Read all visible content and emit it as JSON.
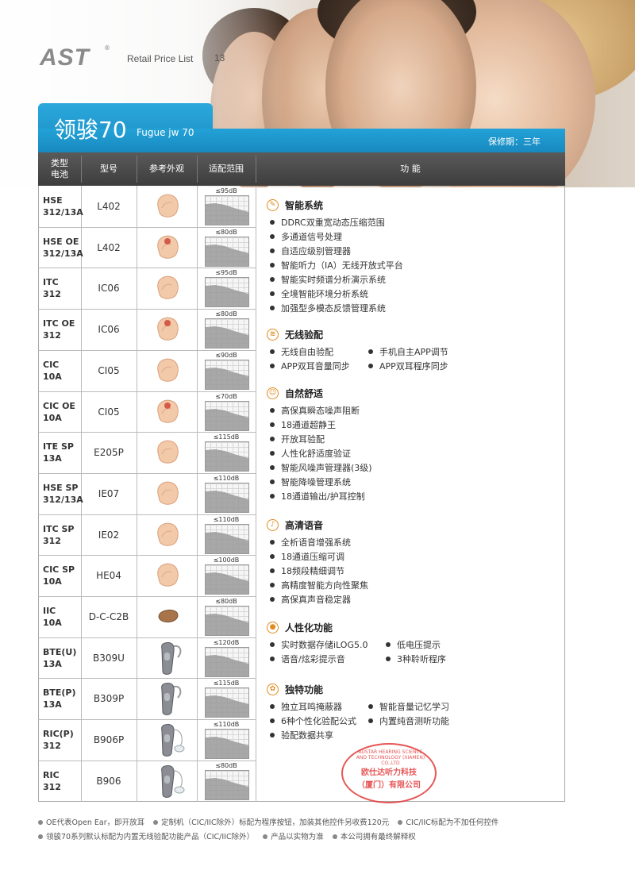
{
  "header": {
    "logo": "AST",
    "logo_reg": "®",
    "title": "Retail Price List",
    "page": "13"
  },
  "product": {
    "name": "领骏70",
    "name_en": "Fugue jw 70",
    "warranty": "保修期：三年"
  },
  "table_header": {
    "type_line1": "类型",
    "type_line2": "电池",
    "model": "型号",
    "look": "参考外观",
    "fit": "适配范围",
    "features": "功  能"
  },
  "rows": [
    {
      "type1": "HSE",
      "type2": "312/13A",
      "model": "L402",
      "fit": "≤95dB"
    },
    {
      "type1": "HSE  OE",
      "type2": "312/13A",
      "model": "L402",
      "fit": "≤80dB"
    },
    {
      "type1": "ITC",
      "type2": "312",
      "model": "IC06",
      "fit": "≤95dB"
    },
    {
      "type1": "ITC  OE",
      "type2": "312",
      "model": "IC06",
      "fit": "≤80dB"
    },
    {
      "type1": "CIC",
      "type2": "10A",
      "model": "CI05",
      "fit": "≤90dB"
    },
    {
      "type1": "CIC  OE",
      "type2": "10A",
      "model": "CI05",
      "fit": "≤70dB"
    },
    {
      "type1": "ITE  SP",
      "type2": "13A",
      "model": "E205P",
      "fit": "≤115dB"
    },
    {
      "type1": "HSE  SP",
      "type2": "312/13A",
      "model": "IE07",
      "fit": "≤110dB"
    },
    {
      "type1": "ITC  SP",
      "type2": "312",
      "model": "IE02",
      "fit": "≤110dB"
    },
    {
      "type1": "CIC  SP",
      "type2": "10A",
      "model": "HE04",
      "fit": "≤100dB"
    },
    {
      "type1": "IIC",
      "type2": "10A",
      "model": "D-C-C2B",
      "fit": "≤80dB"
    },
    {
      "type1": "BTE(U)",
      "type2": "13A",
      "model": "B309U",
      "fit": "≤120dB"
    },
    {
      "type1": "BTE(P)",
      "type2": "13A",
      "model": "B309P",
      "fit": "≤115dB"
    },
    {
      "type1": "RIC(P)",
      "type2": "312",
      "model": "B906P",
      "fit": "≤110dB"
    },
    {
      "type1": "RIC",
      "type2": "312",
      "model": "B906",
      "fit": "≤80dB"
    }
  ],
  "features": {
    "smart": {
      "title": "智能系统",
      "items": [
        "DDRC双重宽动态压缩范围",
        "多通道信号处理",
        "自适应级别管理器",
        "智能听力（IA）无线开放式平台",
        "智能实时频谱分析演示系统",
        "全境智能环境分析系统",
        "加强型多模态反馈管理系统"
      ]
    },
    "wireless": {
      "title": "无线验配",
      "items": [
        "无线自由验配",
        "手机自主APP调节",
        "APP双耳音量同步",
        "APP双耳程序同步"
      ]
    },
    "comfort": {
      "title": "自然舒适",
      "items": [
        "高保真瞬态噪声阻断",
        "18通道超静王",
        "开放耳验配",
        "人性化舒适度验证",
        "智能风噪声管理器(3级)",
        "智能降噪管理系统",
        "18通道输出/护耳控制"
      ]
    },
    "speech": {
      "title": "高清语音",
      "items": [
        "全析语音增强系统",
        "18通道压缩可调",
        "18频段精细调节",
        "高精度智能方向性聚焦",
        "高保真声音稳定器"
      ]
    },
    "human": {
      "title": "人性化功能",
      "items": [
        "实时数据存储iLOG5.0",
        "低电压提示",
        "语音/炫彩提示音",
        "3种聆听程序"
      ]
    },
    "unique": {
      "title": "独特功能",
      "items": [
        "独立耳鸣掩蔽器",
        "智能音量记忆学习",
        "6种个性化验配公式",
        "内置纯音测听功能",
        "验配数据共享"
      ]
    }
  },
  "stamp": {
    "en": "AUSTAR HEARING SCIENCE AND TECHNOLOGY (XIAMEN) CO.,LTD",
    "cn1": "欧仕达听力科技",
    "cn2": "（厦门）有限公司"
  },
  "footer": {
    "line1": [
      "OE代表Open Ear，即开放耳",
      "定制机（CIC/IIC除外）标配为程序按钮，加装其他控件另收费120元",
      "CIC/IIC标配为不加任何控件"
    ],
    "line2": [
      "领骏70系列默认标配为内置无线验配功能产品（CIC/IIC除外）",
      "产品以实物为准",
      "本公司拥有最终解释权"
    ]
  }
}
